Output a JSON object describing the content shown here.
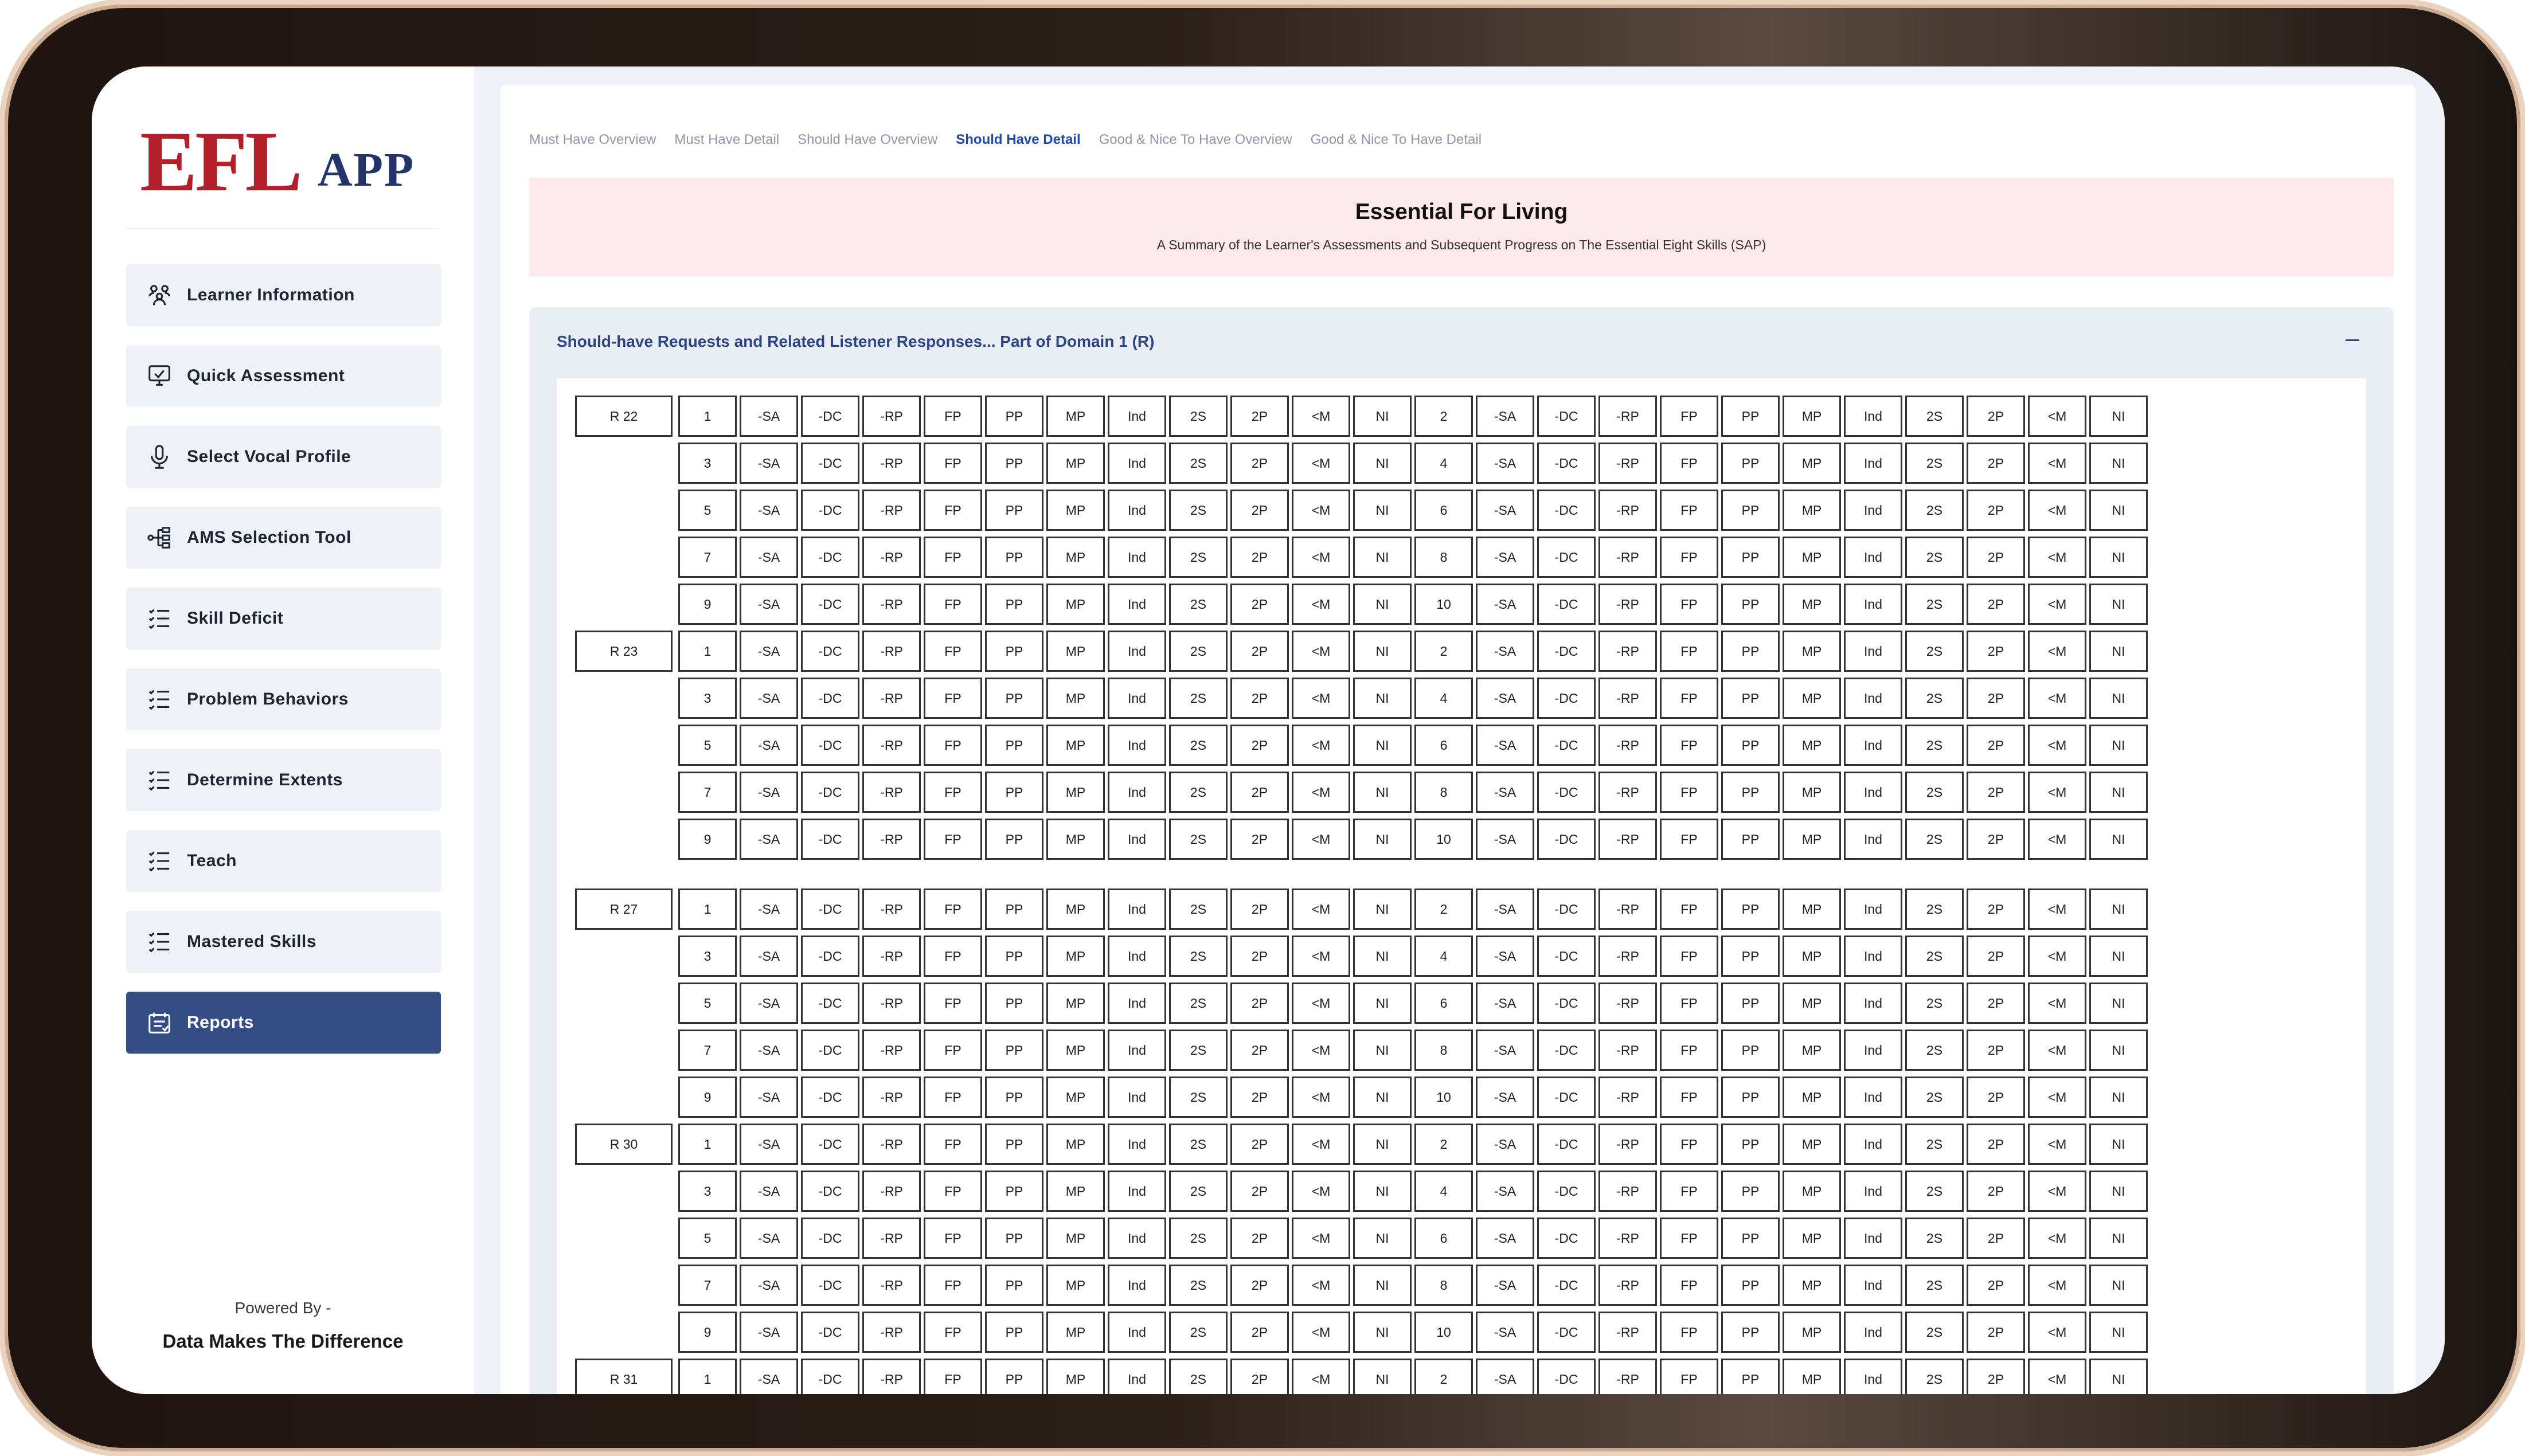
{
  "sidebar": {
    "logo_main": "EFL",
    "logo_sub": "APP",
    "items": [
      {
        "label": "Learner Information",
        "icon": "people-icon"
      },
      {
        "label": "Quick Assessment",
        "icon": "monitor-check-icon"
      },
      {
        "label": "Select Vocal Profile",
        "icon": "microphone-icon"
      },
      {
        "label": "AMS Selection Tool",
        "icon": "hierarchy-icon"
      },
      {
        "label": "Skill Deficit",
        "icon": "list-check-icon"
      },
      {
        "label": "Problem Behaviors",
        "icon": "list-check-icon"
      },
      {
        "label": "Determine Extents",
        "icon": "list-check-icon"
      },
      {
        "label": "Teach",
        "icon": "list-check-icon"
      },
      {
        "label": "Mastered Skills",
        "icon": "list-check-icon"
      },
      {
        "label": "Reports",
        "icon": "report-icon",
        "active": true
      }
    ],
    "powered_by": "Powered By -",
    "company": "Data Makes The Difference"
  },
  "tabs": [
    {
      "label": "Must Have Overview"
    },
    {
      "label": "Must Have Detail"
    },
    {
      "label": "Should Have Overview"
    },
    {
      "label": "Should Have Detail",
      "active": true
    },
    {
      "label": "Good & Nice To Have Overview"
    },
    {
      "label": "Good & Nice To Have Detail"
    }
  ],
  "banner": {
    "title": "Essential For Living",
    "subtitle": "A Summary of the Learner's Assessments and Subsequent Progress on The Essential Eight Skills (SAP)"
  },
  "section": {
    "title": "Should-have Requests and Related Listener Responses... Part of Domain 1 (R)"
  },
  "grid": {
    "codes": [
      "-SA",
      "-DC",
      "-RP",
      "FP",
      "PP",
      "MP",
      "Ind",
      "2S",
      "2P",
      "<M",
      "NI"
    ],
    "rows_per_group": [
      [
        "1",
        "2"
      ],
      [
        "3",
        "4"
      ],
      [
        "5",
        "6"
      ],
      [
        "7",
        "8"
      ],
      [
        "9",
        "10"
      ]
    ],
    "groups": [
      {
        "label": "R 22"
      },
      {
        "label": "R 23"
      },
      {
        "label": "R 27"
      },
      {
        "label": "R 30"
      },
      {
        "label": "R 31"
      }
    ]
  },
  "colors": {
    "brand_red": "#b4202a",
    "brand_navy": "#22356b",
    "active_nav": "#344e85",
    "banner_bg": "#fde8ec",
    "active_tab": "#1f4aa8"
  }
}
